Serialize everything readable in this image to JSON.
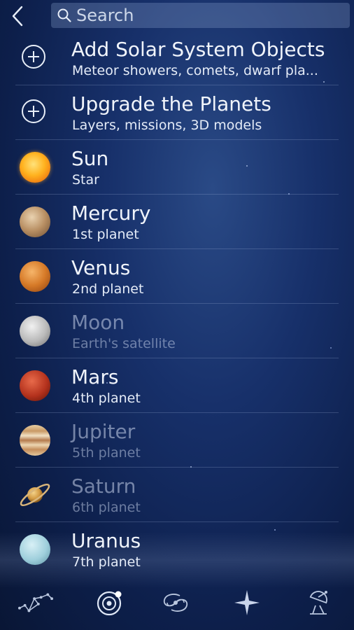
{
  "header": {
    "search_placeholder": "Search"
  },
  "items": [
    {
      "title": "Add Solar System Objects",
      "subtitle": "Meteor showers, comets, dwarf pla...",
      "icon": "plus-circle-icon"
    },
    {
      "title": "Upgrade the Planets",
      "subtitle": "Layers, missions, 3D models",
      "icon": "plus-circle-icon"
    },
    {
      "title": "Sun",
      "subtitle": "Star",
      "icon": "sun-icon"
    },
    {
      "title": "Mercury",
      "subtitle": "1st planet",
      "icon": "mercury-icon"
    },
    {
      "title": "Venus",
      "subtitle": "2nd planet",
      "icon": "venus-icon"
    },
    {
      "title": "Moon",
      "subtitle": "Earth's satellite",
      "icon": "moon-icon"
    },
    {
      "title": "Mars",
      "subtitle": "4th planet",
      "icon": "mars-icon"
    },
    {
      "title": "Jupiter",
      "subtitle": "5th planet",
      "icon": "jupiter-icon"
    },
    {
      "title": "Saturn",
      "subtitle": "6th planet",
      "icon": "saturn-icon"
    },
    {
      "title": "Uranus",
      "subtitle": "7th planet",
      "icon": "uranus-icon"
    }
  ],
  "toolbar": {
    "tabs": [
      "constellations-icon",
      "solar-system-icon",
      "deep-sky-icon",
      "stars-icon",
      "satellites-icon"
    ],
    "active": "solar-system-icon"
  },
  "colors": {
    "background": "#17306a",
    "text": "#f0f4fb",
    "dim_text": "#8f9bb3",
    "search_field": "#5f77a8"
  }
}
